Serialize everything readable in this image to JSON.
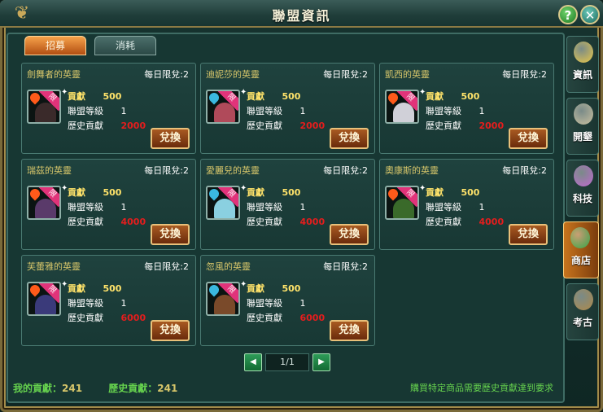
{
  "window": {
    "title": "聯盟資訊",
    "help_label": "?",
    "close_label": "✕"
  },
  "tabs": [
    {
      "label": "招募",
      "active": true
    },
    {
      "label": "消耗",
      "active": false
    }
  ],
  "cards": [
    {
      "name": "劍舞者的英靈",
      "limit": "每日限兌:2",
      "contrib_label": "貢獻",
      "contrib": "500",
      "level_label": "聯盟等級",
      "level": "1",
      "history_label": "歷史貢獻",
      "history": "2000",
      "button": "兌換",
      "badge": "限",
      "element": "fire",
      "hero_color": "#3a2a2a"
    },
    {
      "name": "迪妮莎的英靈",
      "limit": "每日限兌:2",
      "contrib_label": "貢獻",
      "contrib": "500",
      "level_label": "聯盟等級",
      "level": "1",
      "history_label": "歷史貢獻",
      "history": "2000",
      "button": "兌換",
      "badge": "限",
      "element": "water",
      "hero_color": "#b04a5a"
    },
    {
      "name": "凱西的英靈",
      "limit": "每日限兌:2",
      "contrib_label": "貢獻",
      "contrib": "500",
      "level_label": "聯盟等級",
      "level": "1",
      "history_label": "歷史貢獻",
      "history": "2000",
      "button": "兌換",
      "badge": "限",
      "element": "fire",
      "hero_color": "#d0d0d8"
    },
    {
      "name": "瑞茲的英靈",
      "limit": "每日限兌:2",
      "contrib_label": "貢獻",
      "contrib": "500",
      "level_label": "聯盟等級",
      "level": "1",
      "history_label": "歷史貢獻",
      "history": "4000",
      "button": "兌換",
      "badge": "限",
      "element": "fire",
      "hero_color": "#5a3a6a"
    },
    {
      "name": "愛麗兒的英靈",
      "limit": "每日限兌:2",
      "contrib_label": "貢獻",
      "contrib": "500",
      "level_label": "聯盟等級",
      "level": "1",
      "history_label": "歷史貢獻",
      "history": "4000",
      "button": "兌換",
      "badge": "限",
      "element": "water",
      "hero_color": "#8ad0e0"
    },
    {
      "name": "奧康斯的英靈",
      "limit": "每日限兌:2",
      "contrib_label": "貢獻",
      "contrib": "500",
      "level_label": "聯盟等級",
      "level": "1",
      "history_label": "歷史貢獻",
      "history": "4000",
      "button": "兌換",
      "badge": "限",
      "element": "fire",
      "hero_color": "#3a6a2a"
    },
    {
      "name": "芙蕾雅的英靈",
      "limit": "每日限兌:2",
      "contrib_label": "貢獻",
      "contrib": "500",
      "level_label": "聯盟等級",
      "level": "1",
      "history_label": "歷史貢獻",
      "history": "6000",
      "button": "兌換",
      "badge": "限",
      "element": "fire",
      "hero_color": "#3a3a7a"
    },
    {
      "name": "忽風的英靈",
      "limit": "每日限兌:2",
      "contrib_label": "貢獻",
      "contrib": "500",
      "level_label": "聯盟等級",
      "level": "1",
      "history_label": "歷史貢獻",
      "history": "6000",
      "button": "兌換",
      "badge": "限",
      "element": "water",
      "hero_color": "#7a4a2a"
    }
  ],
  "pager": {
    "prev": "◀",
    "next": "▶",
    "page": "1/1"
  },
  "footer": {
    "my_contrib_label": "我的貢獻：",
    "my_contrib": "241",
    "history_contrib_label": "歷史貢獻：",
    "history_contrib": "241",
    "notice": "購買特定商品需要歷史貢獻達到要求"
  },
  "sidenav": [
    {
      "label": "資訊",
      "icon": "avatar-icon",
      "active": false,
      "color": "#e8c84a"
    },
    {
      "label": "開墾",
      "icon": "hammer-icon",
      "active": false,
      "color": "#c9c0a0"
    },
    {
      "label": "科技",
      "icon": "flask-icon",
      "active": false,
      "color": "#c06ad0"
    },
    {
      "label": "商店",
      "icon": "treasure-icon",
      "active": true,
      "color": "#3aa84a"
    },
    {
      "label": "考古",
      "icon": "pickaxe-icon",
      "active": false,
      "color": "#b08a4a"
    }
  ]
}
